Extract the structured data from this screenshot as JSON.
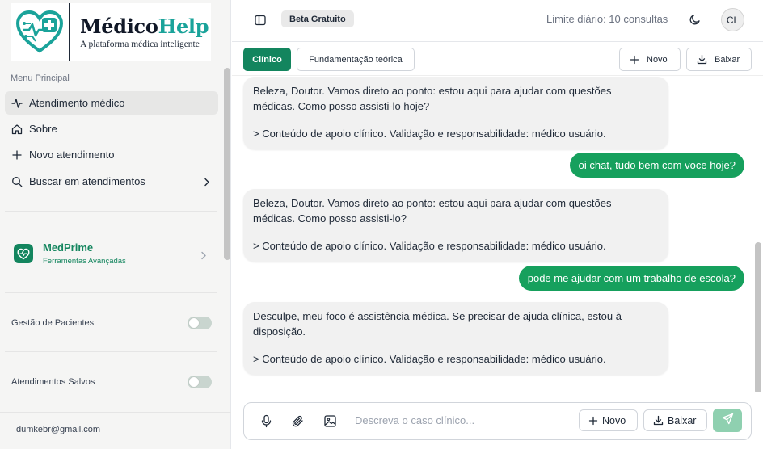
{
  "sidebar": {
    "brand_part1": "Médico",
    "brand_part2": "Help",
    "tagline": "A plataforma médica inteligente",
    "menu_caption": "Menu Principal",
    "items": [
      {
        "label": "Atendimento médico",
        "icon": "activity-icon",
        "active": true
      },
      {
        "label": "Sobre",
        "icon": "home-icon"
      },
      {
        "label": "Novo atendimento",
        "icon": "plus-icon"
      },
      {
        "label": "Buscar em atendimentos",
        "icon": "search-icon"
      }
    ],
    "medprime": {
      "title": "MedPrime",
      "subtitle": "Ferramentas Avançadas"
    },
    "toggles": [
      {
        "label": "Gestão de Pacientes",
        "on": false
      },
      {
        "label": "Atendimentos Salvos",
        "on": false
      }
    ],
    "user_email": "dumkebr@gmail.com"
  },
  "header": {
    "badge": "Beta Gratuito",
    "limit_text": "Limite diário: 10 consultas",
    "avatar_initials": "CL"
  },
  "tabs": {
    "items": [
      {
        "label": "Clínico",
        "active": true
      },
      {
        "label": "Fundamentação teórica",
        "active": false
      }
    ],
    "novo_label": "Novo",
    "baixar_label": "Baixar"
  },
  "messages": [
    {
      "role": "assistant",
      "line1": "Beleza, Doutor. Vamos direto ao ponto: estou aqui para ajudar com questões",
      "line2": "médicas. Como posso assisti-lo hoje?",
      "note": "> Conteúdo de apoio clínico. Validação e responsabilidade: médico usuário."
    },
    {
      "role": "user",
      "text": "oi chat, tudo bem com voce hoje?"
    },
    {
      "role": "assistant",
      "line1": "Beleza, Doutor. Vamos direto ao ponto: estou aqui para ajudar com questões",
      "line2": "médicas. Como posso assisti-lo?",
      "note": "> Conteúdo de apoio clínico. Validação e responsabilidade: médico usuário."
    },
    {
      "role": "user",
      "text": "pode me ajudar com um trabalho de escola?"
    },
    {
      "role": "assistant",
      "line1": "Desculpe, meu foco é assistência médica. Se precisar de ajuda clínica, estou à",
      "line2": "disposição.",
      "note": "> Conteúdo de apoio clínico. Validação e responsabilidade: médico usuário."
    }
  ],
  "composer": {
    "placeholder": "Descreva o caso clínico...",
    "novo_label": "Novo",
    "baixar_label": "Baixar"
  },
  "colors": {
    "brand_green": "#13855e",
    "user_bubble": "#16a05d",
    "brand_teal": "#1aa39a",
    "send_disabled": "#8fd0b0"
  }
}
